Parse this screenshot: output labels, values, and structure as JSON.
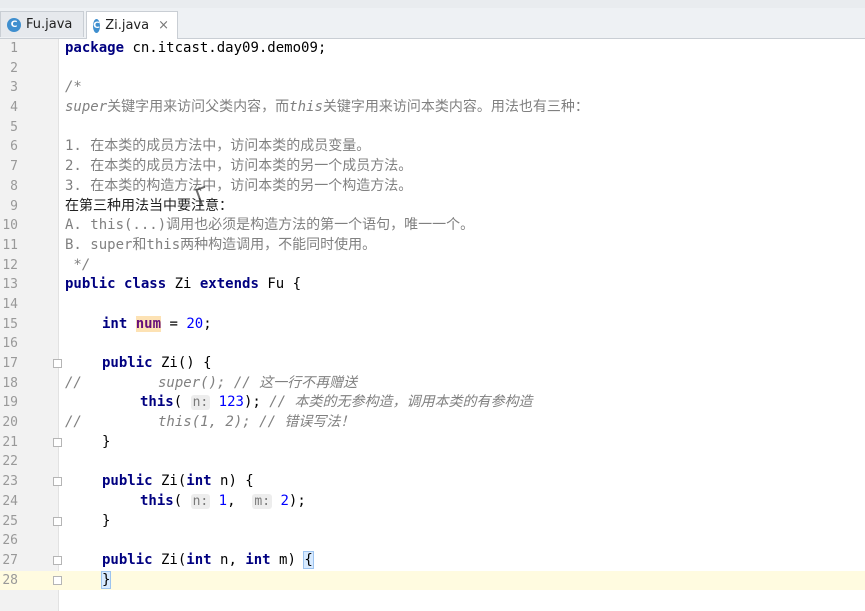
{
  "tabs": [
    {
      "label": "Fu.java",
      "icon": "class-c-icon",
      "active": false
    },
    {
      "label": "Zi.java",
      "icon": "class-c-icon",
      "active": true
    }
  ],
  "icon_glyph": "C",
  "close_glyph": "×",
  "lines": {
    "n1": "1",
    "n2": "2",
    "n3": "3",
    "n4": "4",
    "n5": "5",
    "n6": "6",
    "n7": "7",
    "n8": "8",
    "n9": "9",
    "n10": "10",
    "n11": "11",
    "n12": "12",
    "n13": "13",
    "n14": "14",
    "n15": "15",
    "n16": "16",
    "n17": "17",
    "n18": "18",
    "n19": "19",
    "n20": "20",
    "n21": "21",
    "n22": "22",
    "n23": "23",
    "n24": "24",
    "n25": "25",
    "n26": "26",
    "n27": "27",
    "n28": "28"
  },
  "code": {
    "l1_kw": "package",
    "l1_rest": " cn.itcast.day09.demo09;",
    "l3": "/*",
    "l4_a": "super",
    "l4_b": "关键字用来访问父类内容，而",
    "l4_c": "this",
    "l4_d": "关键字用来访问本类内容。用法也有三种：",
    "l6": "1. 在本类的成员方法中，访问本类的成员变量。",
    "l7": "2. 在本类的成员方法中，访问本类的另一个成员方法。",
    "l8": "3. 在本类的构造方法中，访问本类的另一个构造方法。",
    "l9": "在第三种用法当中要注意：",
    "l10": "A. this(...)调用也必须是构造方法的第一个语句，唯一一个。",
    "l11": "B. super和this两种构造调用，不能同时使用。",
    "l12": " */",
    "l13_kw": "public class",
    "l13_name": " Zi ",
    "l13_kw2": "extends",
    "l13_rest": " Fu {",
    "l15_kw": "int",
    "l15_field": "num",
    "l15_eq": " = ",
    "l15_num": "20",
    "l15_end": ";",
    "l17_kw": "public",
    "l17_rest": " Zi() {",
    "l18_pre": "//",
    "l18_body": "super(); // 这一行不再赠送",
    "l19_kw": "this",
    "l19_open": "( ",
    "l19_hint": "n:",
    "l19_num": " 123",
    "l19_mid": "); ",
    "l19_cm": "// 本类的无参构造，调用本类的有参构造",
    "l20_pre": "//",
    "l20_body": "this(1, 2); // 错误写法！",
    "l21": "}",
    "l23_kw": "public",
    "l23_a": " Zi(",
    "l23_kw2": "int",
    "l23_b": " n) {",
    "l24_kw": "this",
    "l24_open": "( ",
    "l24_h1": "n:",
    "l24_n1": " 1",
    "l24_sep": ",  ",
    "l24_h2": "m:",
    "l24_n2": " 2",
    "l24_end": ");",
    "l25": "}",
    "l27_kw": "public",
    "l27_a": " Zi(",
    "l27_kw2": "int",
    "l27_b": " n, ",
    "l27_kw3": "int",
    "l27_c": " m) ",
    "l27_brace": "{",
    "l28_brace": "}"
  }
}
